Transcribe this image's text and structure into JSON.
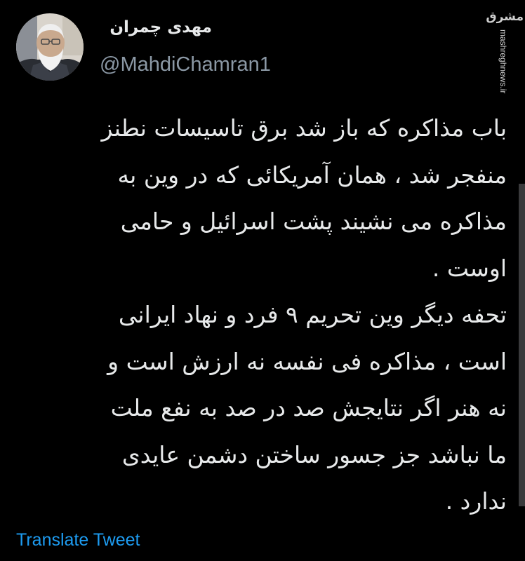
{
  "author": {
    "display_name": "مهدی چمران",
    "handle": "@MahdiChamran1"
  },
  "watermark": {
    "logo_text": "مشرق",
    "url": "mashreghnews.ir"
  },
  "tweet": {
    "lines": [
      "باب مذاکره که باز شد برق تاسیسات نطنز",
      "منفجر شد ، همان آمریکائی که در وین به",
      "مذاکره می نشیند پشت اسرائیل و حامی",
      "اوست .",
      "تحفه دیگر وین تحریم ۹ فرد و نهاد ایرانی",
      "است ، مذاکره فی نفسه نه ارزش است و",
      "نه هنر اگر نتایجش صد در صد به نفع ملت",
      "ما نباشد جز جسور ساختن دشمن عایدی",
      "ندارد ."
    ]
  },
  "actions": {
    "translate_label": "Translate Tweet"
  },
  "colors": {
    "background": "#000000",
    "text_primary": "#e7e9ea",
    "text_secondary": "#8b98a5",
    "link": "#1d9bf0"
  },
  "icons": {
    "avatar": "profile-photo-avatar",
    "watermark": "mashregh-logo"
  }
}
